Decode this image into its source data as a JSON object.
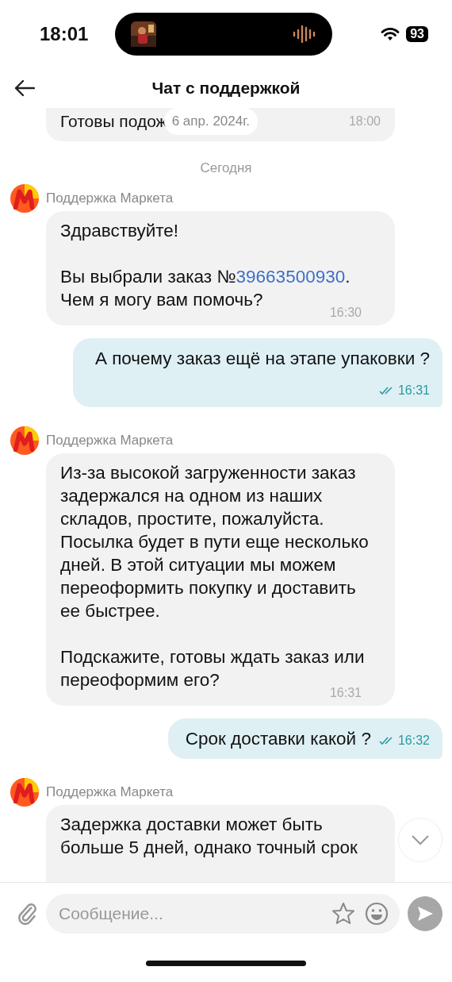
{
  "status_bar": {
    "time": "18:01",
    "battery": "93"
  },
  "header": {
    "title": "Чат с поддержкой"
  },
  "messages": [
    {
      "kind": "preview",
      "text": "Готовы подож",
      "time": "18:00",
      "date": "6 апр. 2024г."
    },
    {
      "kind": "separator",
      "text": "Сегодня"
    },
    {
      "kind": "incoming",
      "sender": "Поддержка Маркета",
      "paragraphs": [
        [
          {
            "text": "Здравствуйте!"
          }
        ],
        [
          {
            "text": "Вы выбрали заказ №"
          },
          {
            "text": "39663500930",
            "kind": "link"
          },
          {
            "text": ". Чем я могу вам помочь?"
          }
        ]
      ],
      "time": "16:30"
    },
    {
      "kind": "outgoing",
      "text": "А почему заказ ещё на этапе упаковки ?",
      "time": "16:31",
      "read": true
    },
    {
      "kind": "incoming",
      "sender": "Поддержка Маркета",
      "paragraphs": [
        [
          {
            "text": "Из-за высокой загруженности заказ задержался на одном из наших складов, простите, пожалуйста. Посылка будет в пути еще несколько дней. В этой ситуации мы можем переоформить покупку и доставить ее быстрее."
          }
        ],
        [
          {
            "text": "Подскажите, готовы ждать заказ или переоформим его?"
          }
        ]
      ],
      "time": "16:31"
    },
    {
      "kind": "outgoing",
      "text": "Срок доставки какой ?",
      "time": "16:32",
      "read": true
    },
    {
      "kind": "incoming",
      "sender": "Поддержка Маркета",
      "paragraphs": [
        [
          {
            "text": "Задержка доставки может быть больше 5 дней, однако точный срок"
          }
        ]
      ],
      "cut": true
    }
  ],
  "composer": {
    "placeholder": "Сообщение...",
    "send_enabled": false
  }
}
